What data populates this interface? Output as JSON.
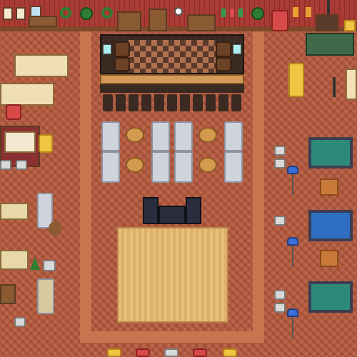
{
  "scene": {
    "title": "",
    "floor_color": "#b4573a",
    "wall_color": "#a83b34"
  },
  "wall_decor": {
    "items": [
      "portrait-frame",
      "portrait-frame",
      "window",
      "wreath",
      "potted-plant",
      "wreath",
      "cabinet",
      "cabinet",
      "wall-clock",
      "christmas-stocking",
      "christmas-stocking",
      "christmas-stocking",
      "potted-plant",
      "throne-chair",
      "fireplace",
      "flag"
    ]
  },
  "bar_area": {
    "counter_stools": 12,
    "barrels": 4
  },
  "lounge_area": {
    "sofas": 8,
    "round_tables": 4
  },
  "stage_area": {
    "speakers": 3,
    "stage": "wooden-stage"
  },
  "game_area": {
    "tables": [
      {
        "kind": "billiard-table",
        "color": "#2d8a78"
      },
      {
        "kind": "air-hockey-table",
        "color": "#2d6ec0"
      },
      {
        "kind": "billiard-table",
        "color": "#2d8a78"
      }
    ],
    "floor_lamps": 3
  },
  "left_area": {
    "bookshelves": 2,
    "armchairs": 3,
    "teddy_bear": "teddy-bear"
  }
}
